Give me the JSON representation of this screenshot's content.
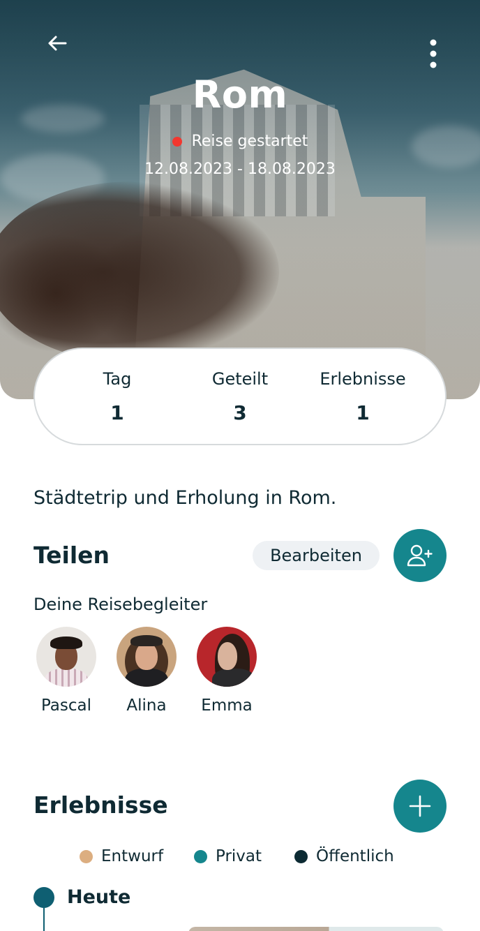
{
  "header": {
    "title": "Rom",
    "status": "Reise gestartet",
    "dates": "12.08.2023 - 18.08.2023",
    "status_color": "#f2372f"
  },
  "stats": [
    {
      "label": "Tag",
      "value": "1"
    },
    {
      "label": "Geteilt",
      "value": "3"
    },
    {
      "label": "Erlebnisse",
      "value": "1"
    }
  ],
  "description": "Städtetrip und Erholung in Rom.",
  "share": {
    "title": "Teilen",
    "edit_label": "Bearbeiten",
    "companions_label": "Deine Reisebegleiter",
    "companions": [
      {
        "name": "Pascal"
      },
      {
        "name": "Alina"
      },
      {
        "name": "Emma"
      }
    ]
  },
  "experiences": {
    "title": "Erlebnisse",
    "legend": [
      {
        "label": "Entwurf",
        "color": "#dcae80"
      },
      {
        "label": "Privat",
        "color": "#15868d"
      },
      {
        "label": "Öffentlich",
        "color": "#0c2a33"
      }
    ],
    "today_label": "Heute"
  },
  "colors": {
    "accent": "#15868d",
    "text": "#0f2a33",
    "chip_bg": "#eef1f4"
  },
  "icons": {
    "back": "arrow-left-icon",
    "more": "more-vertical-icon",
    "add_user": "user-plus-icon",
    "add": "plus-icon"
  }
}
